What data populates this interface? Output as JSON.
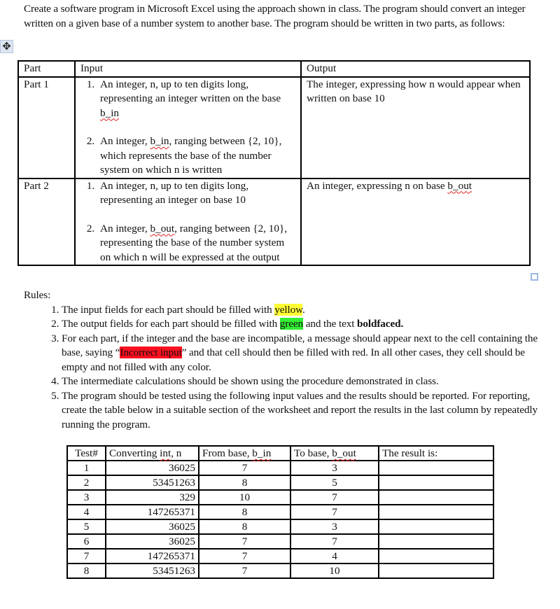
{
  "intro": {
    "text": "Create a software program in Microsoft Excel using the approach shown in class.  The program should convert an integer written on a given base of a number system to another base.  The program should be written in two parts, as follows:"
  },
  "icons": {
    "move_handle": "four-arrow-move-icon",
    "resize_handle": "square-resize-icon"
  },
  "spec_table": {
    "headers": [
      "Part",
      "Input",
      "Output"
    ],
    "rows": [
      {
        "part": "Part 1",
        "inputs": [
          {
            "before": "An integer, n, up to ten digits long, representing an integer written on the base ",
            "squiggle": "b_in",
            "after": ""
          },
          {
            "before": "An integer, ",
            "squiggle": "b_in",
            "after": ", ranging between {2, 10}, which represents the base of the number system on which n is written"
          }
        ],
        "output": {
          "before": "The integer, expressing how n would appear when written on base 10",
          "squiggle": "",
          "after": ""
        }
      },
      {
        "part": "Part 2",
        "inputs": [
          {
            "before": "An integer, n, up to ten digits long, representing an integer on base 10",
            "squiggle": "",
            "after": ""
          },
          {
            "before": "An integer, ",
            "squiggle": "b_out",
            "after": ", ranging between {2, 10}, representing the base of the number system on which n will be expressed at the output"
          }
        ],
        "output": {
          "before": "An integer, expressing n on base ",
          "squiggle": "b_out",
          "after": ""
        }
      }
    ]
  },
  "rules": {
    "heading": "Rules:",
    "items": [
      {
        "before": "The input fields for each part should be filled with ",
        "highlight": "yellow",
        "after": "."
      },
      {
        "before": "The output fields for each part should be filled with ",
        "highlight": "green",
        "middle": " and the text ",
        "bold": "boldfaced",
        "after": "."
      },
      {
        "before": "For each part, if the integer and the base are incompatible, a message should appear next to the cell containing the base, saying “",
        "highlight": "Incorrect input",
        "after": "” and that cell should then be filled with red.  In all other cases, they cell should be empty and not filled with any color."
      },
      {
        "text": "The intermediate calculations should be shown using the procedure demonstrated in class."
      },
      {
        "text": "The program should be tested using the following input values and the results should be reported.  For reporting, create the table below in a suitable section of the worksheet and report the results in the last column by repeatedly running the program."
      }
    ],
    "colors": {
      "yellow": "#ffff33",
      "green": "#33ee33",
      "red": "#ff1020"
    }
  },
  "test_table": {
    "headers": [
      {
        "before": "Test#",
        "squiggle": "",
        "after": ""
      },
      {
        "before": "Converting ",
        "squiggle": "int",
        "after": ", n"
      },
      {
        "before": "From base, ",
        "squiggle": "b_in",
        "after": ""
      },
      {
        "before": "To base, ",
        "squiggle": "b_out",
        "after": ""
      },
      {
        "before": "The result is:",
        "squiggle": "",
        "after": ""
      }
    ],
    "rows": [
      {
        "test": "1",
        "n": "36025",
        "b_in": "7",
        "b_out": "3",
        "result": ""
      },
      {
        "test": "2",
        "n": "53451263",
        "b_in": "8",
        "b_out": "5",
        "result": ""
      },
      {
        "test": "3",
        "n": "329",
        "b_in": "10",
        "b_out": "7",
        "result": ""
      },
      {
        "test": "4",
        "n": "147265371",
        "b_in": "8",
        "b_out": "7",
        "result": ""
      },
      {
        "test": "5",
        "n": "36025",
        "b_in": "8",
        "b_out": "3",
        "result": ""
      },
      {
        "test": "6",
        "n": "36025",
        "b_in": "7",
        "b_out": "7",
        "result": ""
      },
      {
        "test": "7",
        "n": "147265371",
        "b_in": "7",
        "b_out": "4",
        "result": ""
      },
      {
        "test": "8",
        "n": "53451263",
        "b_in": "7",
        "b_out": "10",
        "result": ""
      }
    ]
  }
}
